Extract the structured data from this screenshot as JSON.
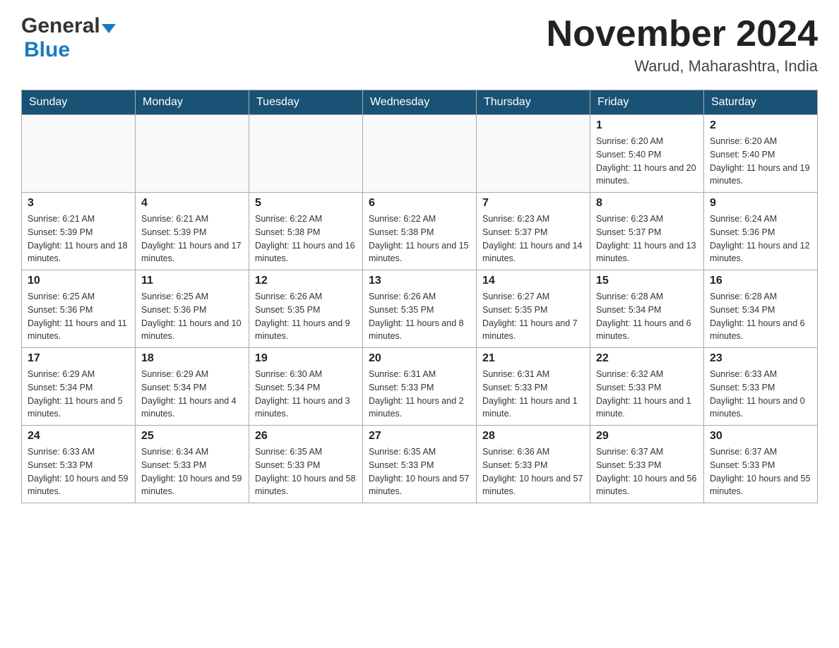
{
  "header": {
    "logo_general": "General",
    "logo_blue": "Blue",
    "month_title": "November 2024",
    "location": "Warud, Maharashtra, India"
  },
  "days_of_week": [
    "Sunday",
    "Monday",
    "Tuesday",
    "Wednesday",
    "Thursday",
    "Friday",
    "Saturday"
  ],
  "weeks": [
    [
      {
        "day": "",
        "info": ""
      },
      {
        "day": "",
        "info": ""
      },
      {
        "day": "",
        "info": ""
      },
      {
        "day": "",
        "info": ""
      },
      {
        "day": "",
        "info": ""
      },
      {
        "day": "1",
        "info": "Sunrise: 6:20 AM\nSunset: 5:40 PM\nDaylight: 11 hours and 20 minutes."
      },
      {
        "day": "2",
        "info": "Sunrise: 6:20 AM\nSunset: 5:40 PM\nDaylight: 11 hours and 19 minutes."
      }
    ],
    [
      {
        "day": "3",
        "info": "Sunrise: 6:21 AM\nSunset: 5:39 PM\nDaylight: 11 hours and 18 minutes."
      },
      {
        "day": "4",
        "info": "Sunrise: 6:21 AM\nSunset: 5:39 PM\nDaylight: 11 hours and 17 minutes."
      },
      {
        "day": "5",
        "info": "Sunrise: 6:22 AM\nSunset: 5:38 PM\nDaylight: 11 hours and 16 minutes."
      },
      {
        "day": "6",
        "info": "Sunrise: 6:22 AM\nSunset: 5:38 PM\nDaylight: 11 hours and 15 minutes."
      },
      {
        "day": "7",
        "info": "Sunrise: 6:23 AM\nSunset: 5:37 PM\nDaylight: 11 hours and 14 minutes."
      },
      {
        "day": "8",
        "info": "Sunrise: 6:23 AM\nSunset: 5:37 PM\nDaylight: 11 hours and 13 minutes."
      },
      {
        "day": "9",
        "info": "Sunrise: 6:24 AM\nSunset: 5:36 PM\nDaylight: 11 hours and 12 minutes."
      }
    ],
    [
      {
        "day": "10",
        "info": "Sunrise: 6:25 AM\nSunset: 5:36 PM\nDaylight: 11 hours and 11 minutes."
      },
      {
        "day": "11",
        "info": "Sunrise: 6:25 AM\nSunset: 5:36 PM\nDaylight: 11 hours and 10 minutes."
      },
      {
        "day": "12",
        "info": "Sunrise: 6:26 AM\nSunset: 5:35 PM\nDaylight: 11 hours and 9 minutes."
      },
      {
        "day": "13",
        "info": "Sunrise: 6:26 AM\nSunset: 5:35 PM\nDaylight: 11 hours and 8 minutes."
      },
      {
        "day": "14",
        "info": "Sunrise: 6:27 AM\nSunset: 5:35 PM\nDaylight: 11 hours and 7 minutes."
      },
      {
        "day": "15",
        "info": "Sunrise: 6:28 AM\nSunset: 5:34 PM\nDaylight: 11 hours and 6 minutes."
      },
      {
        "day": "16",
        "info": "Sunrise: 6:28 AM\nSunset: 5:34 PM\nDaylight: 11 hours and 6 minutes."
      }
    ],
    [
      {
        "day": "17",
        "info": "Sunrise: 6:29 AM\nSunset: 5:34 PM\nDaylight: 11 hours and 5 minutes."
      },
      {
        "day": "18",
        "info": "Sunrise: 6:29 AM\nSunset: 5:34 PM\nDaylight: 11 hours and 4 minutes."
      },
      {
        "day": "19",
        "info": "Sunrise: 6:30 AM\nSunset: 5:34 PM\nDaylight: 11 hours and 3 minutes."
      },
      {
        "day": "20",
        "info": "Sunrise: 6:31 AM\nSunset: 5:33 PM\nDaylight: 11 hours and 2 minutes."
      },
      {
        "day": "21",
        "info": "Sunrise: 6:31 AM\nSunset: 5:33 PM\nDaylight: 11 hours and 1 minute."
      },
      {
        "day": "22",
        "info": "Sunrise: 6:32 AM\nSunset: 5:33 PM\nDaylight: 11 hours and 1 minute."
      },
      {
        "day": "23",
        "info": "Sunrise: 6:33 AM\nSunset: 5:33 PM\nDaylight: 11 hours and 0 minutes."
      }
    ],
    [
      {
        "day": "24",
        "info": "Sunrise: 6:33 AM\nSunset: 5:33 PM\nDaylight: 10 hours and 59 minutes."
      },
      {
        "day": "25",
        "info": "Sunrise: 6:34 AM\nSunset: 5:33 PM\nDaylight: 10 hours and 59 minutes."
      },
      {
        "day": "26",
        "info": "Sunrise: 6:35 AM\nSunset: 5:33 PM\nDaylight: 10 hours and 58 minutes."
      },
      {
        "day": "27",
        "info": "Sunrise: 6:35 AM\nSunset: 5:33 PM\nDaylight: 10 hours and 57 minutes."
      },
      {
        "day": "28",
        "info": "Sunrise: 6:36 AM\nSunset: 5:33 PM\nDaylight: 10 hours and 57 minutes."
      },
      {
        "day": "29",
        "info": "Sunrise: 6:37 AM\nSunset: 5:33 PM\nDaylight: 10 hours and 56 minutes."
      },
      {
        "day": "30",
        "info": "Sunrise: 6:37 AM\nSunset: 5:33 PM\nDaylight: 10 hours and 55 minutes."
      }
    ]
  ]
}
